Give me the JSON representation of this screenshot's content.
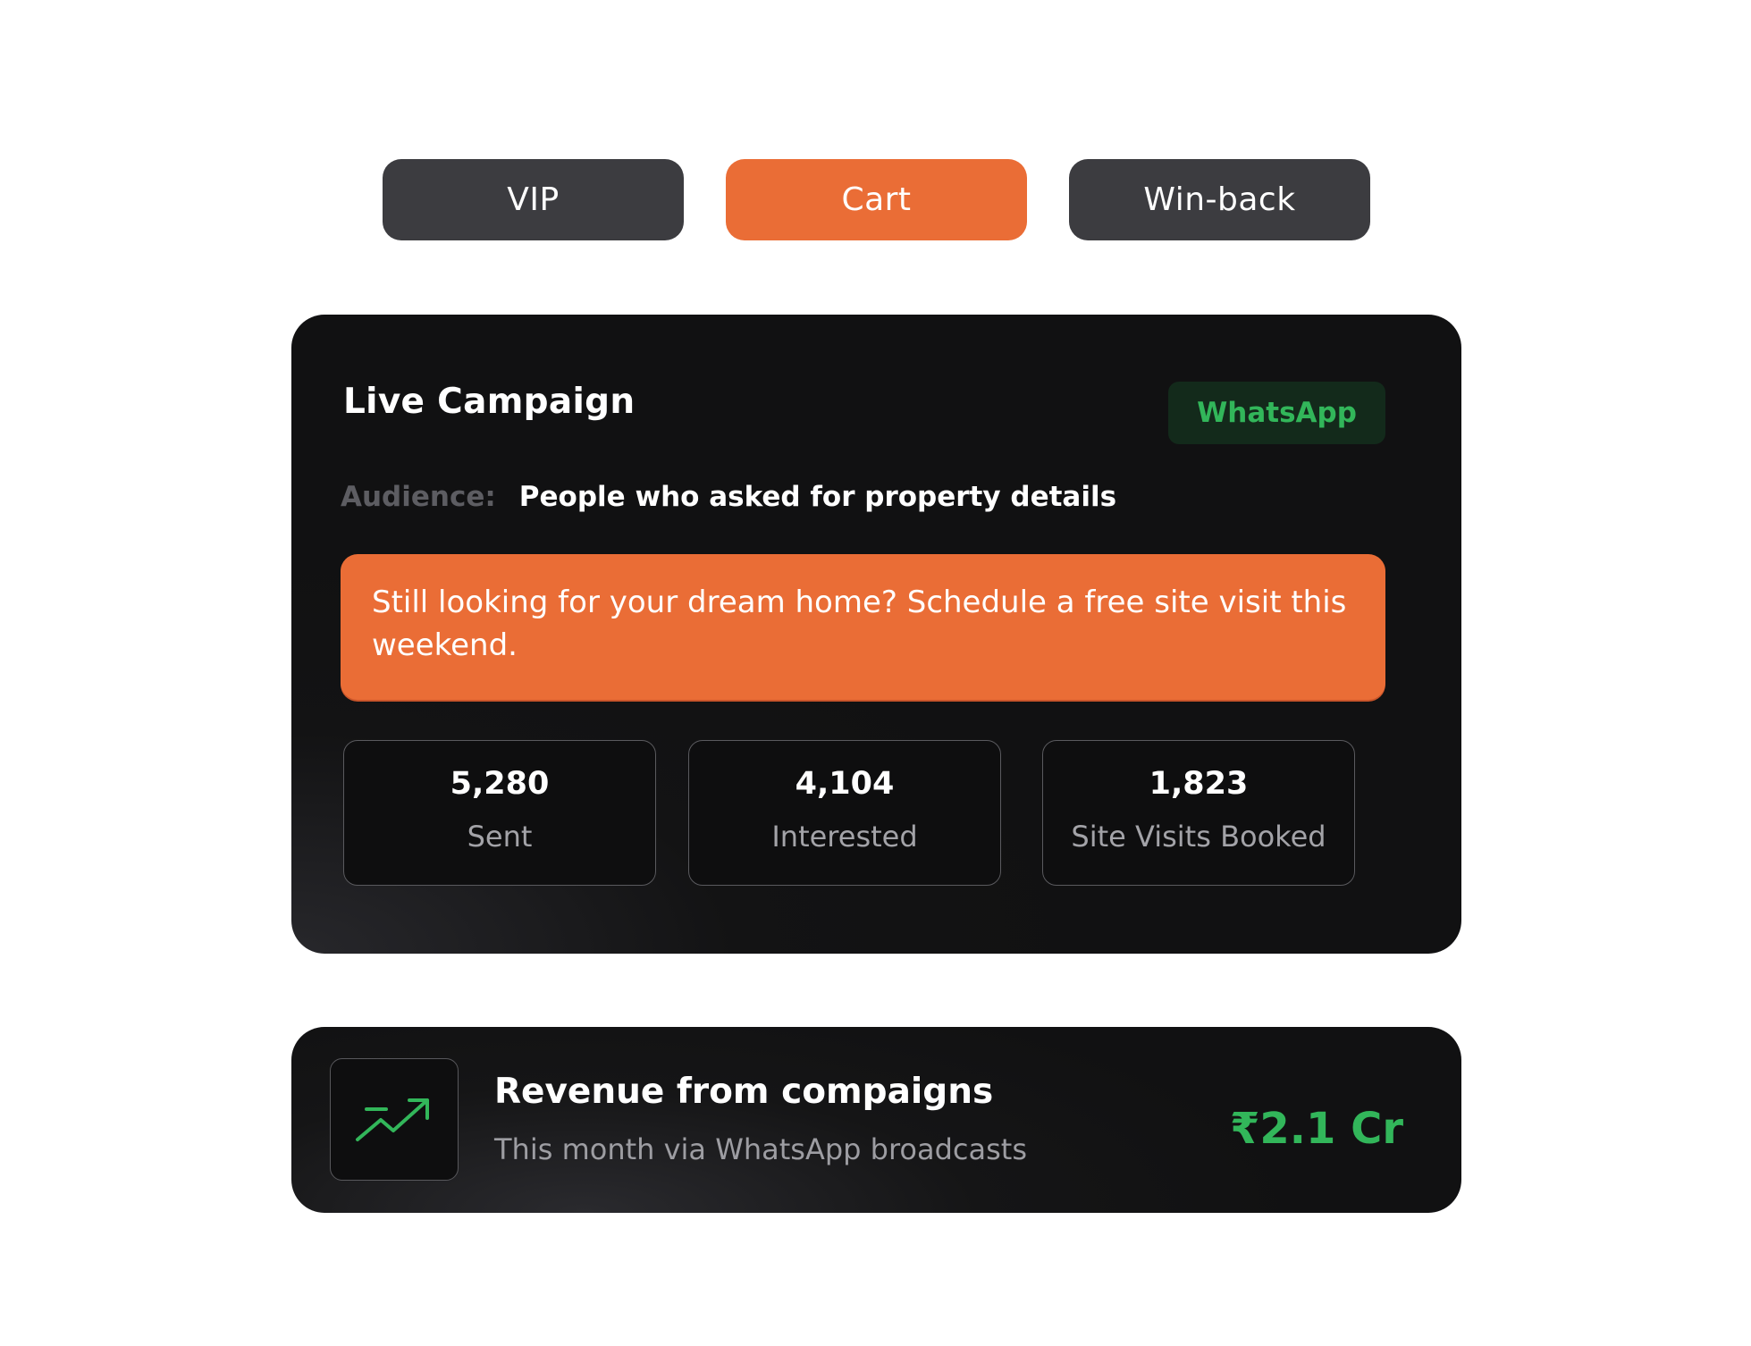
{
  "tabs": [
    {
      "label": "VIP",
      "active": false
    },
    {
      "label": "Cart",
      "active": true
    },
    {
      "label": "Win-back",
      "active": false
    }
  ],
  "campaign": {
    "title": "Live Campaign",
    "channel_badge": "WhatsApp",
    "audience_label": "Audience:",
    "audience_value": "People who asked for property details",
    "message": "Still looking for your dream home? Schedule a free site visit this weekend.",
    "stats": [
      {
        "value": "5,280",
        "label": "Sent"
      },
      {
        "value": "4,104",
        "label": "Interested"
      },
      {
        "value": "1,823",
        "label": "Site Visits Booked"
      }
    ]
  },
  "revenue": {
    "icon": "trending-up-icon",
    "title": "Revenue from compaigns",
    "subtitle": "This month via WhatsApp broadcasts",
    "amount": "₹2.1 Cr"
  },
  "colors": {
    "accent_orange": "#ea6d36",
    "tab_inactive": "#3c3c40",
    "card_bg": "#111112",
    "whatsapp_green": "#32b65a",
    "badge_bg": "#132a1b"
  }
}
